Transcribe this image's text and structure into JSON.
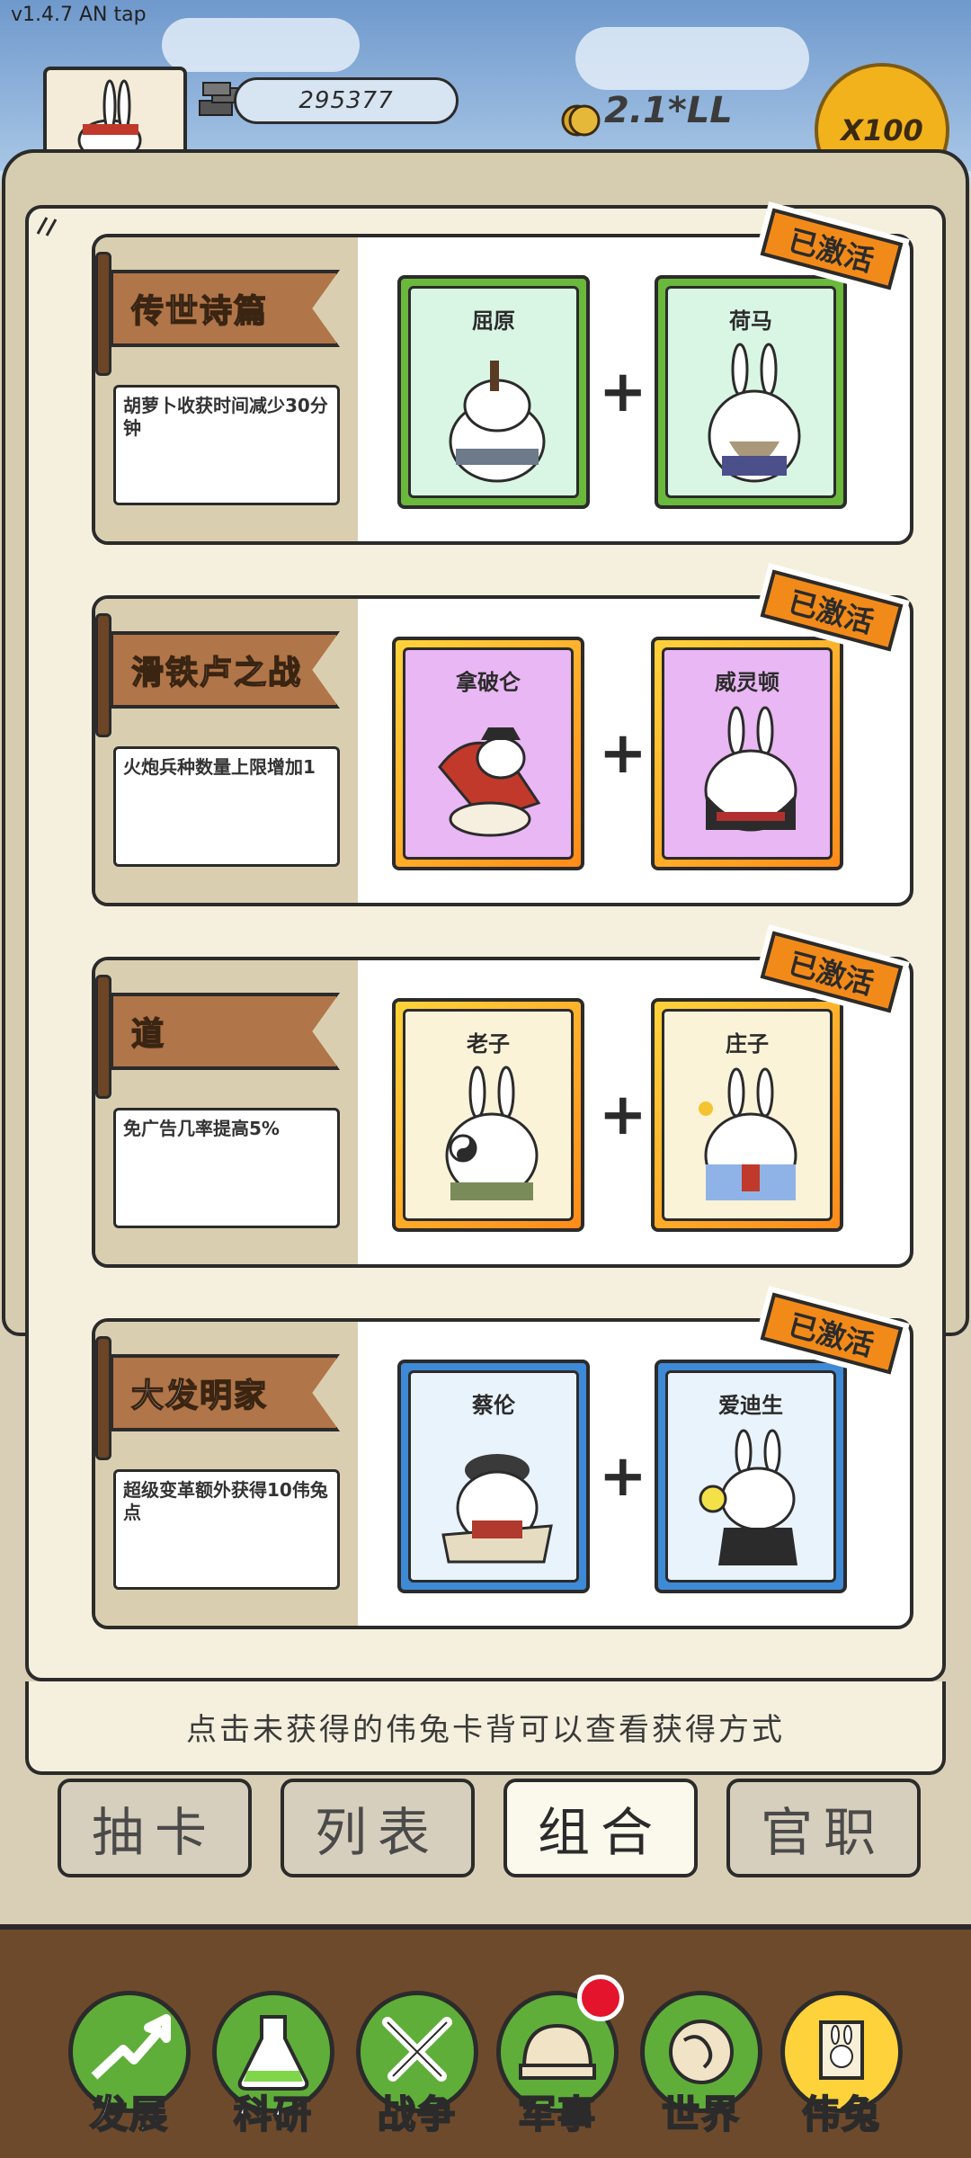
{
  "status": {
    "version": "v1.4.7 AN tap"
  },
  "resources": {
    "ingots": "295377",
    "coins": "2.1*LL",
    "multiplier": "X100"
  },
  "combos": [
    {
      "title": "传世诗篇",
      "description": "胡萝卜收获时间减少30分钟",
      "badge": "已激活",
      "heroes": [
        "屈原",
        "荷马"
      ]
    },
    {
      "title": "滑铁卢之战",
      "description": "火炮兵种数量上限增加1",
      "badge": "已激活",
      "heroes": [
        "拿破仑",
        "威灵顿"
      ]
    },
    {
      "title": "道",
      "description": "免广告几率提高5%",
      "badge": "已激活",
      "heroes": [
        "老子",
        "庄子"
      ]
    },
    {
      "title": "大发明家",
      "description": "超级变革额外获得10伟兔点",
      "badge": "已激活",
      "heroes": [
        "蔡伦",
        "爱迪生"
      ]
    }
  ],
  "hint": "点击未获得的伟兔卡背可以查看获得方式",
  "tabs": [
    "抽卡",
    "列表",
    "组合",
    "官职"
  ],
  "active_tab": "组合",
  "dock": [
    "发展",
    "科研",
    "战争",
    "军事",
    "世界",
    "伟兔"
  ],
  "active_dock": "伟兔",
  "colors": {
    "accent": "#f28a19",
    "dock_green": "#5fae3a",
    "active_dock": "#fdd23a"
  }
}
